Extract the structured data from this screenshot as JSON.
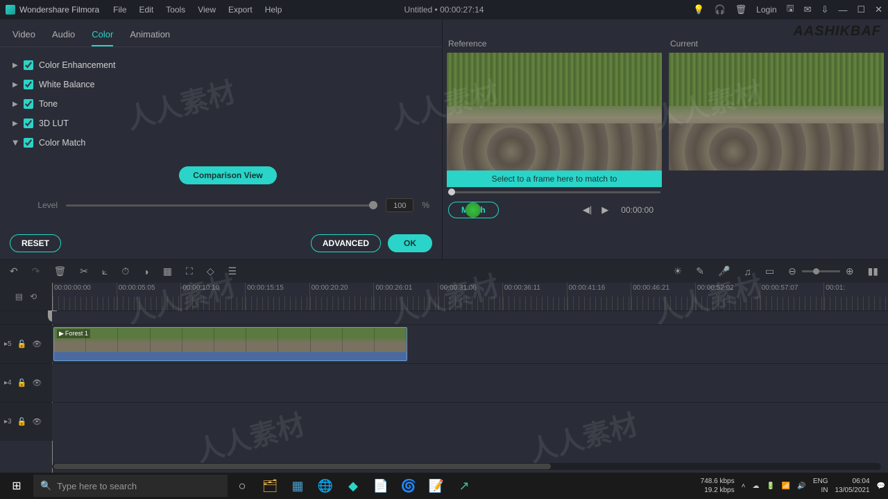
{
  "titlebar": {
    "app_name": "Wondershare Filmora",
    "menu": [
      "File",
      "Edit",
      "Tools",
      "View",
      "Export",
      "Help"
    ],
    "center": "Untitled • 00:00:27:14",
    "login": "Login"
  },
  "brand_watermark": "AASHIKBAF",
  "tabs": [
    "Video",
    "Audio",
    "Color",
    "Animation"
  ],
  "active_tab": "Color",
  "sections": {
    "color_enhancement": "Color Enhancement",
    "white_balance": "White Balance",
    "tone": "Tone",
    "lut": "3D LUT",
    "color_match": "Color Match"
  },
  "color_match": {
    "comparison_view": "Comparison View",
    "level_label": "Level",
    "level_value": "100",
    "level_unit": "%"
  },
  "buttons": {
    "reset": "RESET",
    "advanced": "ADVANCED",
    "ok": "OK",
    "match": "Match"
  },
  "preview": {
    "reference": "Reference",
    "current": "Current",
    "frame_hint": "Select to a frame here to match to",
    "timecode": "00:00:00"
  },
  "ruler_times": [
    "00:00:00:00",
    "00:00:05:05",
    "00:00:10:10",
    "00:00:15:15",
    "00:00:20:20",
    "00:00:26:01",
    "00:00:31:06",
    "00:00:36:11",
    "00:00:41:16",
    "00:00:46:21",
    "00:00:52:02",
    "00:00:57:07",
    "00:01:"
  ],
  "tracks": {
    "t5": "5",
    "t4": "4",
    "t3": "3"
  },
  "clip": {
    "name": "Forest 1"
  },
  "taskbar": {
    "search_placeholder": "Type here to search",
    "net_down": "748.6 kbps",
    "net_up": "19.2 kbps",
    "lang1": "ENG",
    "lang2": "IN",
    "time": "06:04",
    "date": "13/05/2021"
  }
}
